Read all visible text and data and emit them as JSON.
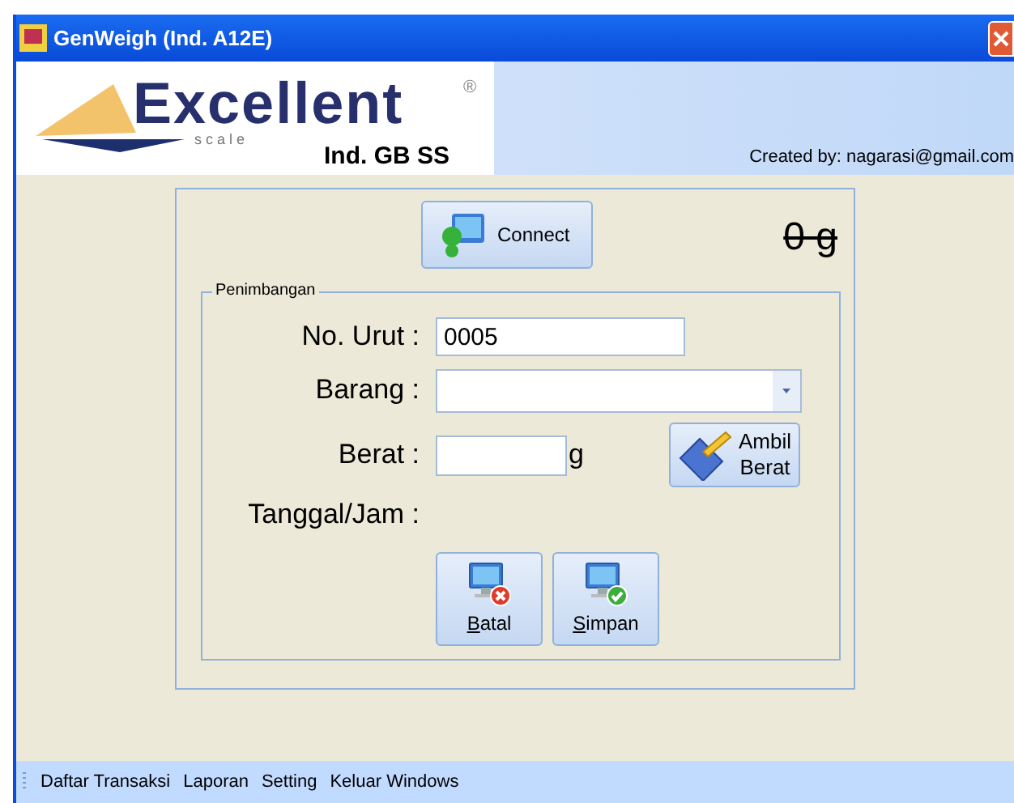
{
  "window": {
    "title": "GenWeigh (Ind. A12E)"
  },
  "header": {
    "logo_word": "Excellent",
    "logo_sub": "s c a l e",
    "logo_mark": "®",
    "edition": "Ind. GB SS",
    "credit": "Created by: nagarasi@gmail.com"
  },
  "connect_button": "Connect",
  "weight_display": "0 g",
  "group": {
    "title": "Penimbangan",
    "fields": [
      {
        "kind": "text",
        "label": "No. Urut :",
        "value": "0005"
      },
      {
        "kind": "select",
        "label": "Barang :"
      },
      {
        "kind": "weight",
        "label": "Berat :",
        "unit": "g",
        "button": "Ambil\nBerat"
      },
      {
        "kind": "static",
        "label": "Tanggal/Jam :"
      }
    ],
    "buttons": [
      {
        "kind": "cancel",
        "label": "Batal"
      },
      {
        "kind": "save",
        "label": "Simpan"
      }
    ]
  },
  "menu": [
    "Daftar Transaksi",
    "Laporan",
    "Setting",
    "Keluar Windows"
  ]
}
